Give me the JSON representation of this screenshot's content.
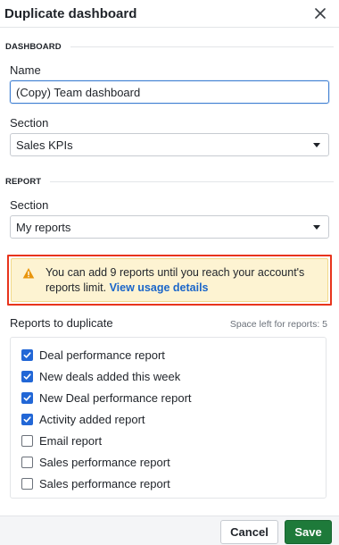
{
  "header": {
    "title": "Duplicate dashboard"
  },
  "dashboard": {
    "section_title": "DASHBOARD",
    "name_label": "Name",
    "name_value": "(Copy) Team dashboard",
    "section_label": "Section",
    "section_value": "Sales KPIs"
  },
  "report": {
    "section_title": "REPORT",
    "section_label": "Section",
    "section_value": "My reports"
  },
  "alert": {
    "text": "You can add 9 reports until you reach your account's reports limit.",
    "link": "View usage details"
  },
  "reports": {
    "label": "Reports to duplicate",
    "space_left": "Space left for reports: 5",
    "items": [
      {
        "label": "Deal performance report",
        "checked": true
      },
      {
        "label": "New deals added this week",
        "checked": true
      },
      {
        "label": "New Deal performance report",
        "checked": true
      },
      {
        "label": "Activity added report",
        "checked": true
      },
      {
        "label": "Email report",
        "checked": false
      },
      {
        "label": "Sales performance report",
        "checked": false
      },
      {
        "label": "Sales performance report",
        "checked": false
      }
    ]
  },
  "footer": {
    "cancel_label": "Cancel",
    "save_label": "Save"
  },
  "colors": {
    "save": "#1e7a3a",
    "checkbox": "#2267d6",
    "link": "#1b66c9",
    "alert_bg": "#fdf3d2",
    "highlight": "#e8341c"
  }
}
